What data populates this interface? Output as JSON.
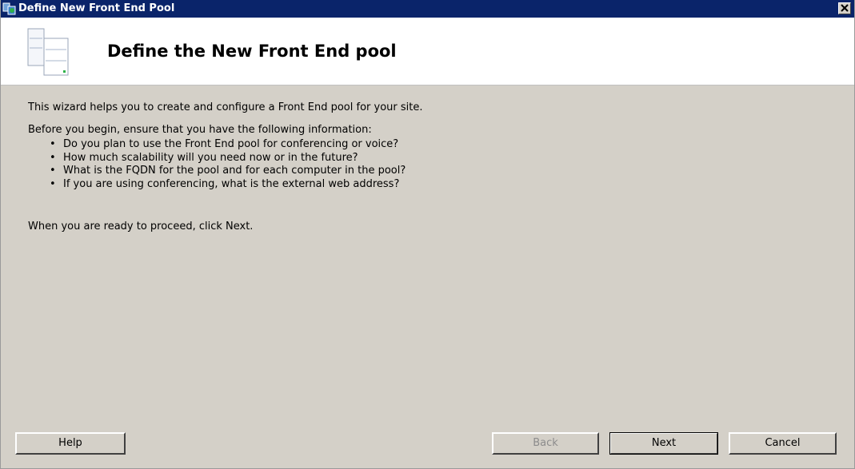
{
  "window": {
    "title": "Define New Front End Pool",
    "icon": "server-pool-icon"
  },
  "header": {
    "title": "Define the New Front End pool",
    "icon": "server-pages-icon"
  },
  "body": {
    "intro": "This wizard helps you to create and configure a Front End pool for your site.",
    "before_you_begin": "Before you begin, ensure that you have the following information:",
    "requirements": [
      "Do you plan to use the Front End pool for conferencing or voice?",
      "How much scalability will you need now or in the future?",
      "What is the FQDN for the pool and for each computer in the pool?",
      "If you are using conferencing, what is the external web address?"
    ],
    "ready": "When you are ready to proceed, click Next."
  },
  "buttons": {
    "help": "Help",
    "back": "Back",
    "next": "Next",
    "cancel": "Cancel"
  },
  "colors": {
    "titlebar": "#0a246a",
    "dialog_background": "#d4d0c8",
    "header_background": "#ffffff"
  }
}
